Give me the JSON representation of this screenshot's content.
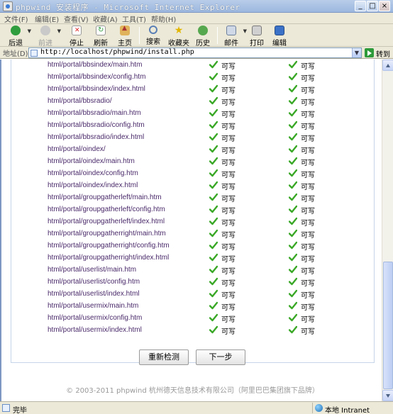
{
  "window": {
    "title": "phpwind 安装程序 - Microsoft Internet Explorer",
    "min": "_",
    "max": "□",
    "close": "×"
  },
  "menu": [
    "文件(F)",
    "编辑(E)",
    "查看(V)",
    "收藏(A)",
    "工具(T)",
    "帮助(H)"
  ],
  "toolbar": {
    "back": "后退",
    "forward": "前进",
    "stop": "停止",
    "refresh": "刷新",
    "home": "主页",
    "search": "搜索",
    "favorites": "收藏夹",
    "history": "历史",
    "mail": "邮件",
    "print": "打印",
    "edit": "编辑"
  },
  "address": {
    "label": "地址(D)",
    "url": "http://localhost/phpwind/install.php",
    "go": "转到"
  },
  "rows": [
    {
      "path": "html/portal/bbsindex/main.htm",
      "s1": "可写",
      "s2": "可写"
    },
    {
      "path": "html/portal/bbsindex/config.htm",
      "s1": "可写",
      "s2": "可写"
    },
    {
      "path": "html/portal/bbsindex/index.html",
      "s1": "可写",
      "s2": "可写"
    },
    {
      "path": "html/portal/bbsradio/",
      "s1": "可写",
      "s2": "可写"
    },
    {
      "path": "html/portal/bbsradio/main.htm",
      "s1": "可写",
      "s2": "可写"
    },
    {
      "path": "html/portal/bbsradio/config.htm",
      "s1": "可写",
      "s2": "可写"
    },
    {
      "path": "html/portal/bbsradio/index.html",
      "s1": "可写",
      "s2": "可写"
    },
    {
      "path": "html/portal/oindex/",
      "s1": "可写",
      "s2": "可写"
    },
    {
      "path": "html/portal/oindex/main.htm",
      "s1": "可写",
      "s2": "可写"
    },
    {
      "path": "html/portal/oindex/config.htm",
      "s1": "可写",
      "s2": "可写"
    },
    {
      "path": "html/portal/oindex/index.html",
      "s1": "可写",
      "s2": "可写"
    },
    {
      "path": "html/portal/groupgatherleft/main.htm",
      "s1": "可写",
      "s2": "可写"
    },
    {
      "path": "html/portal/groupgatherleft/config.htm",
      "s1": "可写",
      "s2": "可写"
    },
    {
      "path": "html/portal/groupgatherleft/index.html",
      "s1": "可写",
      "s2": "可写"
    },
    {
      "path": "html/portal/groupgatherright/main.htm",
      "s1": "可写",
      "s2": "可写"
    },
    {
      "path": "html/portal/groupgatherright/config.htm",
      "s1": "可写",
      "s2": "可写"
    },
    {
      "path": "html/portal/groupgatherright/index.html",
      "s1": "可写",
      "s2": "可写"
    },
    {
      "path": "html/portal/userlist/main.htm",
      "s1": "可写",
      "s2": "可写"
    },
    {
      "path": "html/portal/userlist/config.htm",
      "s1": "可写",
      "s2": "可写"
    },
    {
      "path": "html/portal/userlist/index.html",
      "s1": "可写",
      "s2": "可写"
    },
    {
      "path": "html/portal/usermix/main.htm",
      "s1": "可写",
      "s2": "可写"
    },
    {
      "path": "html/portal/usermix/config.htm",
      "s1": "可写",
      "s2": "可写"
    },
    {
      "path": "html/portal/usermix/index.html",
      "s1": "可写",
      "s2": "可写"
    }
  ],
  "buttons": {
    "recheck": "重新检测",
    "next": "下一步"
  },
  "footer": "© 2003-2011 phpwind 杭州德天信息技术有限公司（阿里巴巴集团旗下品牌）",
  "status": {
    "text": "完毕",
    "zone": "本地 Intranet"
  },
  "colors": {
    "check": "#3aa827",
    "path_text": "#4a2a6a",
    "panel_border": "#c5d4e8"
  }
}
